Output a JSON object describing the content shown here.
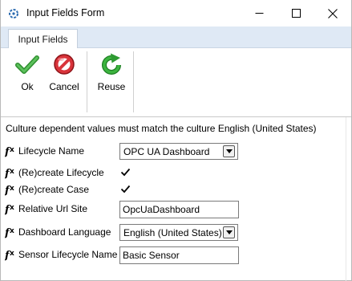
{
  "window": {
    "title": "Input Fields Form",
    "controls": {
      "minimize": "minimize",
      "maximize": "maximize",
      "close": "close"
    }
  },
  "ribbon": {
    "tab_label": "Input Fields",
    "buttons": [
      {
        "label": "Ok",
        "icon": "checkmark-icon",
        "color": "#3a9a3a"
      },
      {
        "label": "Cancel",
        "icon": "cancel-icon",
        "color": "#c0282d"
      },
      {
        "label": "Reuse",
        "icon": "refresh-icon",
        "color": "#2e9a2e"
      }
    ]
  },
  "form": {
    "note": "Culture dependent values must match the culture  English (United States)",
    "fields": [
      {
        "label": "Lifecycle Name",
        "type": "select",
        "value": "OPC UA Dashboard"
      },
      {
        "label": "(Re)create Lifecycle",
        "type": "checkbox",
        "checked": true
      },
      {
        "label": "(Re)create Case",
        "type": "checkbox",
        "checked": true
      },
      {
        "label": "Relative Url Site",
        "type": "text",
        "value": "OpcUaDashboard"
      },
      {
        "label": "Dashboard Language",
        "type": "select",
        "value": "English (United States)"
      },
      {
        "label": "Sensor Lifecycle Name",
        "type": "text",
        "value": "Basic Sensor"
      }
    ]
  }
}
